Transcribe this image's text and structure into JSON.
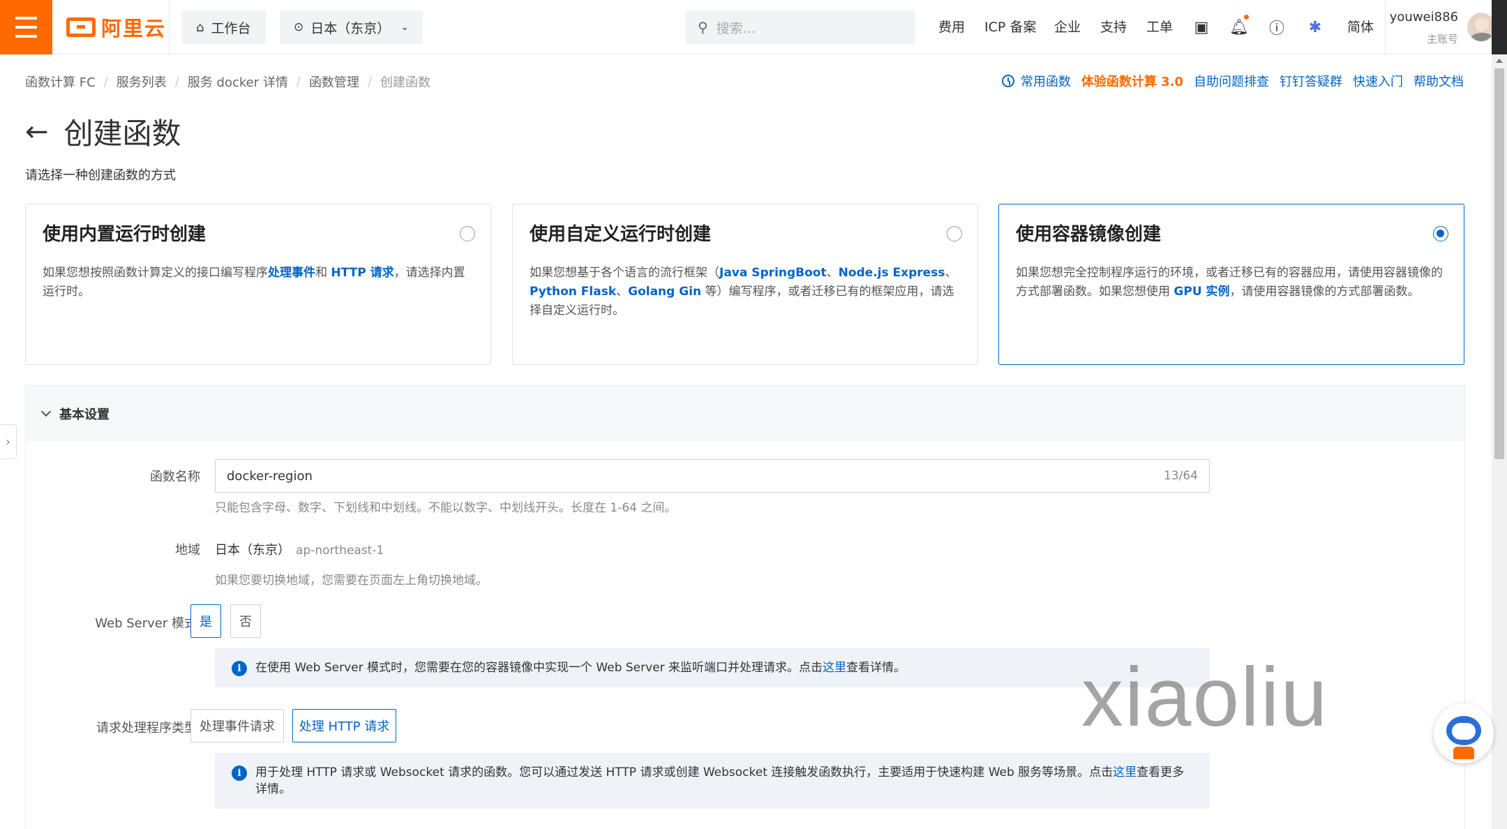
{
  "header": {
    "logo_text": "阿里云",
    "workbench": "工作台",
    "region": "日本（东京）",
    "search_placeholder": "搜索...",
    "nav": [
      "费用",
      "ICP 备案",
      "企业",
      "支持",
      "工单"
    ],
    "lang": "简体",
    "user_name": "youwei886",
    "user_role": "主账号"
  },
  "breadcrumb": [
    "函数计算 FC",
    "服务列表",
    "服务 docker 详情",
    "函数管理",
    "创建函数"
  ],
  "quick_links": {
    "common": "常用函数",
    "try_fc3": "体验函数计算 3.0",
    "self_diagnose": "自助问题排查",
    "dingtalk": "钉钉答疑群",
    "quickstart": "快速入门",
    "docs": "帮助文档"
  },
  "page": {
    "title": "创建函数",
    "subtitle": "请选择一种创建函数的方式"
  },
  "cards": [
    {
      "title": "使用内置运行时创建",
      "desc_a": "如果您想按照函数计算定义的接口编写程序",
      "hl1": "处理事件",
      "desc_b": "和 ",
      "hl2": "HTTP 请求",
      "desc_c": "，请选择内置运行时。",
      "selected": false
    },
    {
      "title": "使用自定义运行时创建",
      "desc_a": "如果您想基于各个语言的流行框架（",
      "hl1": "Java SpringBoot",
      "sep1": "、",
      "hl2": "Node.js Express",
      "sep2": "、",
      "hl3": "Python Flask",
      "sep3": "、",
      "hl4": "Golang Gin",
      "desc_b": " 等）编写程序，或者迁移已有的框架应用，请选择自定义运行时。",
      "selected": false
    },
    {
      "title": "使用容器镜像创建",
      "desc_a": "如果您想完全控制程序运行的环境，或者迁移已有的容器应用，请使用容器镜像的方式部署函数。如果您想使用 ",
      "hl1": "GPU 实例",
      "desc_b": "，请使用容器镜像的方式部署函数。",
      "selected": true
    }
  ],
  "basic": {
    "section_title": "基本设置",
    "fn_name_label": "函数名称",
    "fn_name_value": "docker-region",
    "fn_name_count": "13/64",
    "fn_name_help": "只能包含字母、数字、下划线和中划线。不能以数字、中划线开头。长度在 1-64 之间。",
    "region_label": "地域",
    "region_value": "日本（东京）",
    "region_code": "ap-northeast-1",
    "region_help": "如果您要切换地域，您需要在页面左上角切换地域。",
    "web_server_label": "Web Server 模式",
    "yes": "是",
    "no": "否",
    "web_server_notice_a": "在使用 Web Server 模式时，您需要在您的容器镜像中实现一个 Web Server 来监听端口并处理请求。点击",
    "here": "这里",
    "web_server_notice_b": "查看详情。",
    "handler_label": "请求处理程序类型",
    "handler_event": "处理事件请求",
    "handler_http": "处理 HTTP 请求",
    "handler_notice_a": "用于处理 HTTP 请求或 Websocket 请求的函数。您可以通过发送 HTTP 请求或创建 Websocket 连接触发函数执行，主要适用于快速构建 Web 服务等场景。点击",
    "handler_notice_b": "查看更多详情。"
  },
  "watermark": "xiaoliu",
  "colors": {
    "brand": "#ff6a00",
    "link": "#0064c8"
  }
}
